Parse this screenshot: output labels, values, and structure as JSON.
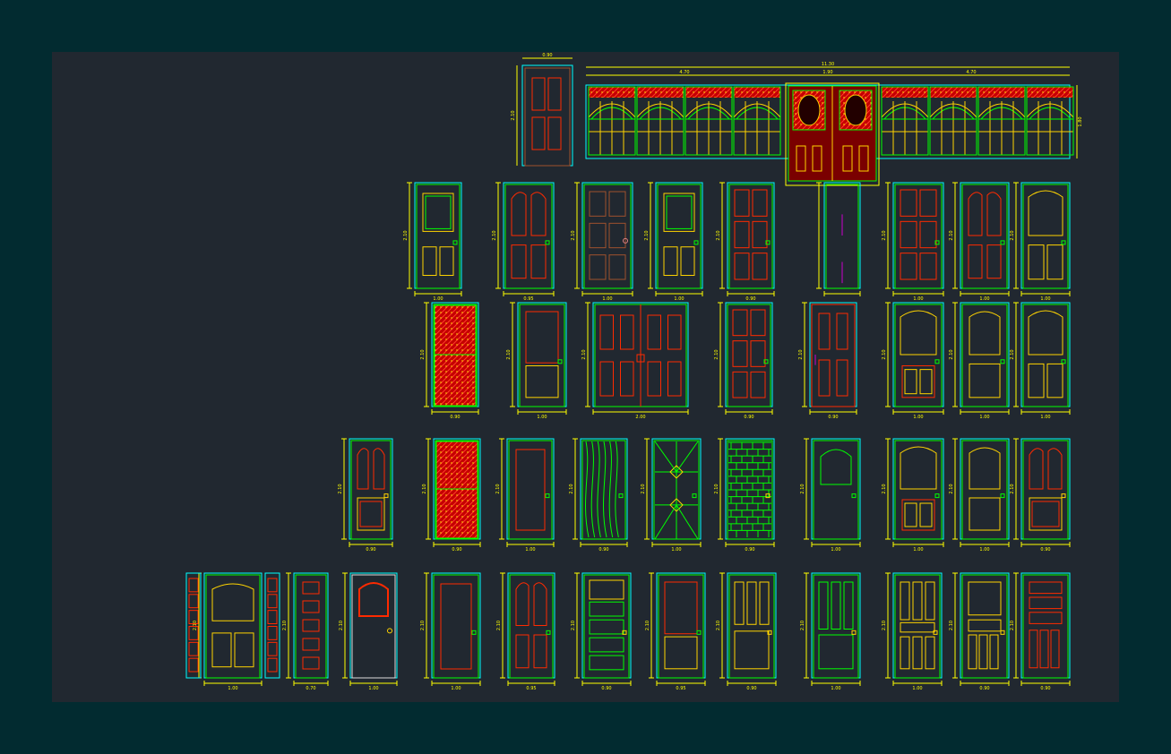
{
  "theme": {
    "frame": "#00FFFF",
    "dim": "#FFFF00",
    "panel_green": "#00FF00",
    "panel_red": "#FF2A00",
    "panel_yellow": "#FFD400",
    "panel_brown": "#A0522D",
    "panel_magenta": "#CC00CC"
  },
  "top": {
    "single_door_width": "0.90",
    "single_door_height": "2.10",
    "facade_total_width": "11.30",
    "facade_left_width": "4.70",
    "facade_center_width": "1.90",
    "facade_right_width": "4.70",
    "facade_height": "1.80"
  },
  "rows": [
    {
      "name": "row-1",
      "doors": [
        {
          "style": "glass-top",
          "w": "1.00",
          "h": "2.10"
        },
        {
          "style": "arched-4",
          "w": "0.95",
          "h": "2.10"
        },
        {
          "style": "brown-6",
          "w": "1.00",
          "h": "2.10"
        },
        {
          "style": "glass-top",
          "w": "1.00",
          "h": "2.10"
        },
        {
          "style": "six-panel",
          "w": "0.90",
          "h": "2.10"
        },
        {
          "style": "blank",
          "w": "",
          "h": ""
        },
        {
          "style": "six-panel",
          "w": "1.00",
          "h": "2.10"
        },
        {
          "style": "arched-4",
          "w": "1.00",
          "h": "2.10"
        },
        {
          "style": "arch-top",
          "w": "1.00",
          "h": "2.10"
        }
      ]
    },
    {
      "name": "row-2",
      "doors": [
        {
          "style": "red-texture",
          "w": "0.90",
          "h": "2.10"
        },
        {
          "style": "two-panel",
          "w": "1.00",
          "h": "2.10"
        },
        {
          "style": "double-red",
          "w": "2.00",
          "h": "2.10"
        },
        {
          "style": "six-panel",
          "w": "0.90",
          "h": "2.10"
        },
        {
          "style": "four-red",
          "w": "0.90",
          "h": "2.10"
        },
        {
          "style": "arch-top-red",
          "w": "1.00",
          "h": "2.10"
        },
        {
          "style": "two-panel-arch",
          "w": "1.00",
          "h": "2.10"
        },
        {
          "style": "arch-top",
          "w": "1.00",
          "h": "2.10"
        }
      ]
    },
    {
      "name": "row-3",
      "doors": [
        {
          "style": "arched-yellow",
          "w": "0.90",
          "h": "2.10"
        },
        {
          "style": "red-texture",
          "w": "0.90",
          "h": "2.10"
        },
        {
          "style": "plain-red",
          "w": "1.00",
          "h": "2.10"
        },
        {
          "style": "wood-grain",
          "w": "0.90",
          "h": "2.10"
        },
        {
          "style": "diamond-glass",
          "w": "1.00",
          "h": "2.10"
        },
        {
          "style": "brick",
          "w": "0.90",
          "h": "2.10"
        },
        {
          "style": "arch-window",
          "w": "1.00",
          "h": "2.10"
        },
        {
          "style": "arch-top-red",
          "w": "1.00",
          "h": "2.10"
        },
        {
          "style": "two-panel-arch",
          "w": "1.00",
          "h": "2.10"
        },
        {
          "style": "arched-yellow",
          "w": "0.90",
          "h": "2.10"
        }
      ]
    },
    {
      "name": "row-4",
      "doors": [
        {
          "style": "sidelights",
          "w": "1.00",
          "h": "2.10"
        },
        {
          "style": "narrow-5",
          "w": "0.70",
          "h": "2.10"
        },
        {
          "style": "arch-window-white",
          "w": "1.00",
          "h": "2.10"
        },
        {
          "style": "plain-red",
          "w": "1.00",
          "h": "2.10"
        },
        {
          "style": "arched-4",
          "w": "0.95",
          "h": "2.10"
        },
        {
          "style": "five-horizontal",
          "w": "0.90",
          "h": "2.10"
        },
        {
          "style": "two-panel",
          "w": "0.95",
          "h": "2.10"
        },
        {
          "style": "three-vertical",
          "w": "0.90",
          "h": "2.10"
        },
        {
          "style": "three-vertical-low",
          "w": "1.00",
          "h": "2.10"
        },
        {
          "style": "multi-vertical",
          "w": "1.00",
          "h": "2.10"
        },
        {
          "style": "mixed",
          "w": "0.90",
          "h": "2.10"
        },
        {
          "style": "mixed-red",
          "w": "0.90",
          "h": "2.10"
        }
      ]
    }
  ]
}
